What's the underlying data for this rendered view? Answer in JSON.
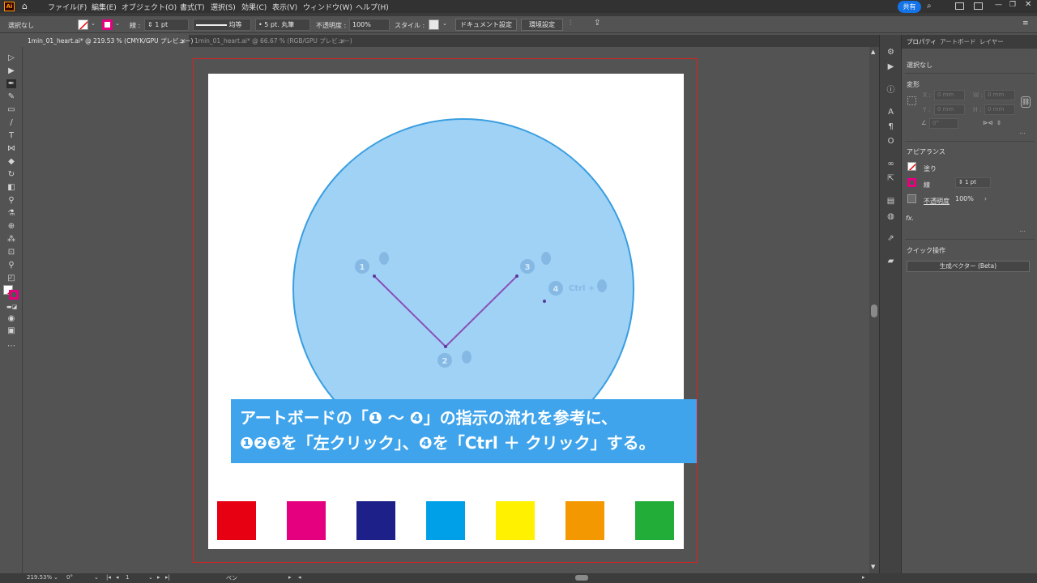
{
  "app": {
    "logo": "Ai",
    "menu": [
      "ファイル(F)",
      "編集(E)",
      "オブジェクト(O)",
      "書式(T)",
      "選択(S)",
      "効果(C)",
      "表示(V)",
      "ウィンドウ(W)",
      "ヘルプ(H)"
    ],
    "share_label": "共有"
  },
  "control": {
    "selection": "選択なし",
    "stroke_label": "線 :",
    "stroke_weight": "1 pt",
    "line_style": "均等",
    "brush": "5 pt. 丸筆",
    "opacity_label": "不透明度 :",
    "opacity_value": "100%",
    "style_label": "スタイル :",
    "document_setup": "ドキュメント設定",
    "preferences": "環境設定"
  },
  "tabs": [
    {
      "label": "1min_01_heart.ai* @ 219.53 % (CMYK/GPU プレビュー)",
      "close": "×"
    },
    {
      "label": "1min_01_heart.ai* @ 66.67 % (RGB/GPU プレビュー)",
      "close": "×"
    }
  ],
  "canvas": {
    "steps": [
      "1",
      "2",
      "3",
      "4"
    ],
    "ctrl_hint": "Ctrl +",
    "caption_line1": "アートボードの「❶ 〜 ❹」の指示の流れを参考に、",
    "caption_line2": "❶❷❸を「左クリック」、❹を「Ctrl ＋ クリック」する。",
    "swatch_colors": [
      "#e60012",
      "#e4007f",
      "#1d2088",
      "#00a0e9",
      "#fff100",
      "#f39800",
      "#22ac38"
    ],
    "circle_fill": "#a0d2f6",
    "circle_stroke": "#3a9ee0",
    "path_color": "#8a4fb8"
  },
  "panel": {
    "tabs": [
      "プロパティ",
      "アートボード",
      "レイヤー"
    ],
    "selection": "選択なし",
    "transform_title": "変形",
    "x_label": "X :",
    "y_label": "Y :",
    "w_label": "W :",
    "h_label": "H :",
    "x_value": "0 mm",
    "y_value": "0 mm",
    "w_value": "0 mm",
    "h_value": "0 mm",
    "angle_value": "0°",
    "appearance_title": "アピアランス",
    "fill_label": "塗り",
    "stroke_label": "線",
    "stroke_value": "1 pt",
    "opacity_label": "不透明度",
    "opacity_value": "100%",
    "fx_label": "fx.",
    "quick_actions_title": "クイック操作",
    "generative_vector": "生成ベクター (Beta)"
  },
  "status": {
    "zoom": "219.53%",
    "rotation": "0°",
    "artboard_index": "1",
    "tool_name": "ペン"
  }
}
